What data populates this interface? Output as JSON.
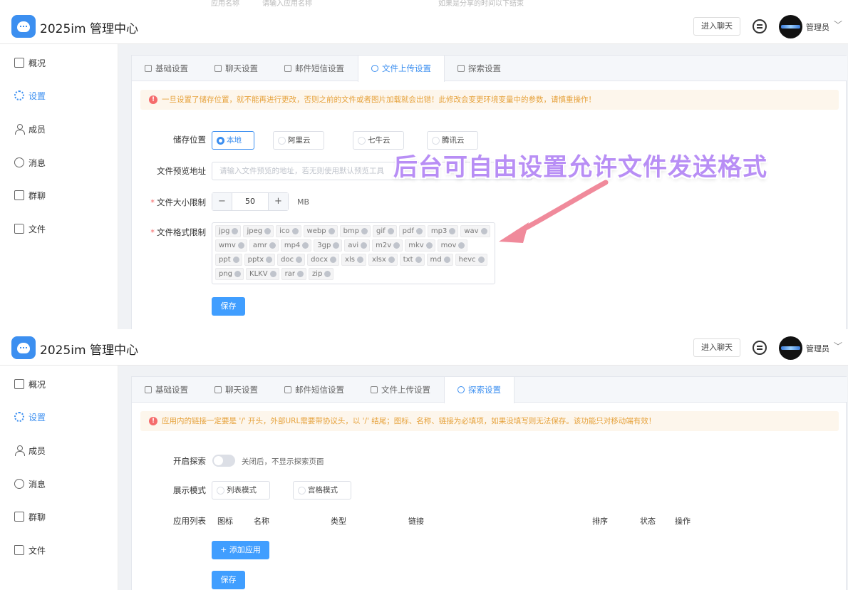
{
  "top_strip": {
    "fragments": [
      "应用名称",
      "请输入应用名称",
      "如果是分享的时间以下结束"
    ]
  },
  "header": {
    "app_title": "2025im 管理中心",
    "chat_button": "进入聊天",
    "user_name": "管理员",
    "caret": "﹀"
  },
  "sidebar": {
    "items": [
      {
        "label": "概况",
        "icon": "dashboard-icon"
      },
      {
        "label": "设置",
        "icon": "gear-icon"
      },
      {
        "label": "成员",
        "icon": "user-icon"
      },
      {
        "label": "消息",
        "icon": "message-icon"
      },
      {
        "label": "群聊",
        "icon": "group-chat-icon"
      },
      {
        "label": "文件",
        "icon": "folder-icon"
      }
    ]
  },
  "tabs": [
    "基础设置",
    "聊天设置",
    "邮件短信设置",
    "文件上传设置",
    "探索设置"
  ],
  "panel1": {
    "active_tab": 3,
    "alert": "一旦设置了储存位置，就不能再进行更改，否则之前的文件或者图片加载就会出错！此修改会变更环境变量中的参数，请慎重操作！",
    "storage_label": "储存位置",
    "storage_options": [
      "本地",
      "阿里云",
      "七牛云",
      "腾讯云"
    ],
    "storage_selected": "本地",
    "preview_label": "文件预览地址",
    "preview_placeholder": "请输入文件预览的地址，若无则使用默认预览工具",
    "size_label": "文件大小限制",
    "size_value": "50",
    "size_unit": "MB",
    "format_label": "文件格式限制",
    "formats": [
      "jpg",
      "jpeg",
      "ico",
      "webp",
      "bmp",
      "gif",
      "pdf",
      "mp3",
      "wav",
      "wmv",
      "amr",
      "mp4",
      "3gp",
      "avi",
      "m2v",
      "mkv",
      "mov",
      "ppt",
      "pptx",
      "doc",
      "docx",
      "xls",
      "xlsx",
      "txt",
      "md",
      "hevc",
      "png",
      "KLKV",
      "rar",
      "zip"
    ],
    "save": "保存",
    "overlay_text": "后台可自由设置允许文件发送格式",
    "accent": "#b88ef5"
  },
  "panel2": {
    "active_tab": 4,
    "alert": "应用内的链接一定要是 '/' 开头，外部URL需要带协议头，以 '/' 结尾；图标、名称、链接为必填项，如果没填写则无法保存。该功能只对移动端有效！",
    "explore_label": "开启探索",
    "explore_hint": "关闭后，不显示探索页面",
    "mode_label": "展示模式",
    "mode_options": [
      "列表模式",
      "宫格模式"
    ],
    "list_label": "应用列表",
    "columns": [
      "图标",
      "名称",
      "类型",
      "链接",
      "排序",
      "状态",
      "操作"
    ],
    "add_button": "+ 添加应用",
    "save": "保存"
  },
  "colors": {
    "primary": "#409eff",
    "warning_bg": "#fdf6ec",
    "warning_text": "#e6a23c"
  }
}
